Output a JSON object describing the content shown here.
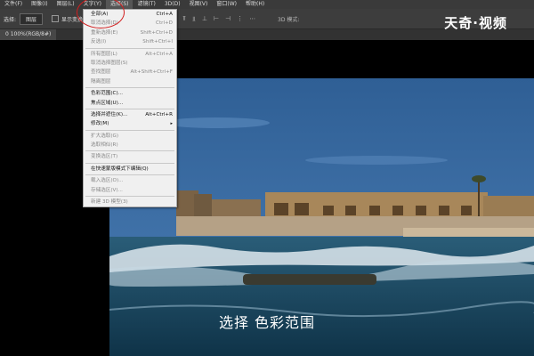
{
  "menubar": {
    "items": [
      "文件(F)",
      "图像(I)",
      "图层(L)",
      "文字(Y)",
      "选择(S)",
      "滤镜(T)",
      "3D(D)",
      "视图(V)",
      "窗口(W)",
      "帮助(H)"
    ]
  },
  "options": {
    "label": "选择:",
    "select_value": "图层",
    "checkbox_label": "显示变换控件",
    "mode3d": "3D 模式:"
  },
  "tab": {
    "label": "0 100%(RGB/8#)"
  },
  "logo": {
    "text": "天奇·视频"
  },
  "subtitle": {
    "text": "选择 色彩范围"
  },
  "select_menu": {
    "items": [
      {
        "label": "全部(A)",
        "shortcut": "Ctrl+A",
        "disabled": false
      },
      {
        "label": "取消选择(D)",
        "shortcut": "Ctrl+D",
        "disabled": true
      },
      {
        "label": "重新选择(E)",
        "shortcut": "Shift+Ctrl+D",
        "disabled": true
      },
      {
        "label": "反选(I)",
        "shortcut": "Shift+Ctrl+I",
        "disabled": true
      },
      {
        "sep": true
      },
      {
        "label": "所有图层(L)",
        "shortcut": "Alt+Ctrl+A",
        "disabled": true
      },
      {
        "label": "取消选择图层(S)",
        "shortcut": "",
        "disabled": true
      },
      {
        "label": "查找图层",
        "shortcut": "Alt+Shift+Ctrl+F",
        "disabled": true
      },
      {
        "label": "隔离图层",
        "shortcut": "",
        "disabled": true
      },
      {
        "sep": true
      },
      {
        "label": "色彩范围(C)...",
        "shortcut": "",
        "disabled": false
      },
      {
        "label": "焦点区域(U)...",
        "shortcut": "",
        "disabled": false
      },
      {
        "sep": true
      },
      {
        "label": "选择并遮住(K)...",
        "shortcut": "Alt+Ctrl+R",
        "disabled": false
      },
      {
        "label": "修改(M)",
        "shortcut": "",
        "disabled": false,
        "submenu": true
      },
      {
        "sep": true
      },
      {
        "label": "扩大选取(G)",
        "shortcut": "",
        "disabled": true
      },
      {
        "label": "选取相似(R)",
        "shortcut": "",
        "disabled": true
      },
      {
        "sep": true
      },
      {
        "label": "变换选区(T)",
        "shortcut": "",
        "disabled": true
      },
      {
        "sep": true
      },
      {
        "label": "在快速蒙版模式下编辑(Q)",
        "shortcut": "",
        "disabled": false
      },
      {
        "sep": true
      },
      {
        "label": "载入选区(O)...",
        "shortcut": "",
        "disabled": true
      },
      {
        "label": "存储选区(V)...",
        "shortcut": "",
        "disabled": true
      },
      {
        "sep": true
      },
      {
        "label": "新建 3D 模型(3)",
        "shortcut": "",
        "disabled": true
      }
    ]
  }
}
